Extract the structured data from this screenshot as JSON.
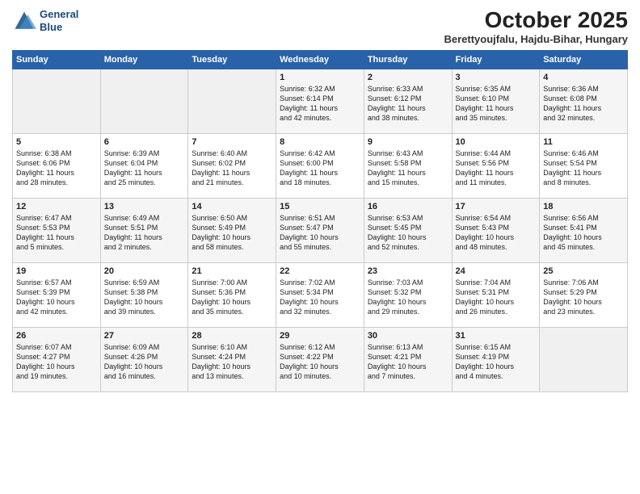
{
  "header": {
    "logo_line1": "General",
    "logo_line2": "Blue",
    "title": "October 2025",
    "subtitle": "Berettyoujfalu, Hajdu-Bihar, Hungary"
  },
  "days_of_week": [
    "Sunday",
    "Monday",
    "Tuesday",
    "Wednesday",
    "Thursday",
    "Friday",
    "Saturday"
  ],
  "weeks": [
    [
      {
        "day": null,
        "info": null
      },
      {
        "day": null,
        "info": null
      },
      {
        "day": null,
        "info": null
      },
      {
        "day": "1",
        "info": "Sunrise: 6:32 AM\nSunset: 6:14 PM\nDaylight: 11 hours\nand 42 minutes."
      },
      {
        "day": "2",
        "info": "Sunrise: 6:33 AM\nSunset: 6:12 PM\nDaylight: 11 hours\nand 38 minutes."
      },
      {
        "day": "3",
        "info": "Sunrise: 6:35 AM\nSunset: 6:10 PM\nDaylight: 11 hours\nand 35 minutes."
      },
      {
        "day": "4",
        "info": "Sunrise: 6:36 AM\nSunset: 6:08 PM\nDaylight: 11 hours\nand 32 minutes."
      }
    ],
    [
      {
        "day": "5",
        "info": "Sunrise: 6:38 AM\nSunset: 6:06 PM\nDaylight: 11 hours\nand 28 minutes."
      },
      {
        "day": "6",
        "info": "Sunrise: 6:39 AM\nSunset: 6:04 PM\nDaylight: 11 hours\nand 25 minutes."
      },
      {
        "day": "7",
        "info": "Sunrise: 6:40 AM\nSunset: 6:02 PM\nDaylight: 11 hours\nand 21 minutes."
      },
      {
        "day": "8",
        "info": "Sunrise: 6:42 AM\nSunset: 6:00 PM\nDaylight: 11 hours\nand 18 minutes."
      },
      {
        "day": "9",
        "info": "Sunrise: 6:43 AM\nSunset: 5:58 PM\nDaylight: 11 hours\nand 15 minutes."
      },
      {
        "day": "10",
        "info": "Sunrise: 6:44 AM\nSunset: 5:56 PM\nDaylight: 11 hours\nand 11 minutes."
      },
      {
        "day": "11",
        "info": "Sunrise: 6:46 AM\nSunset: 5:54 PM\nDaylight: 11 hours\nand 8 minutes."
      }
    ],
    [
      {
        "day": "12",
        "info": "Sunrise: 6:47 AM\nSunset: 5:53 PM\nDaylight: 11 hours\nand 5 minutes."
      },
      {
        "day": "13",
        "info": "Sunrise: 6:49 AM\nSunset: 5:51 PM\nDaylight: 11 hours\nand 2 minutes."
      },
      {
        "day": "14",
        "info": "Sunrise: 6:50 AM\nSunset: 5:49 PM\nDaylight: 10 hours\nand 58 minutes."
      },
      {
        "day": "15",
        "info": "Sunrise: 6:51 AM\nSunset: 5:47 PM\nDaylight: 10 hours\nand 55 minutes."
      },
      {
        "day": "16",
        "info": "Sunrise: 6:53 AM\nSunset: 5:45 PM\nDaylight: 10 hours\nand 52 minutes."
      },
      {
        "day": "17",
        "info": "Sunrise: 6:54 AM\nSunset: 5:43 PM\nDaylight: 10 hours\nand 48 minutes."
      },
      {
        "day": "18",
        "info": "Sunrise: 6:56 AM\nSunset: 5:41 PM\nDaylight: 10 hours\nand 45 minutes."
      }
    ],
    [
      {
        "day": "19",
        "info": "Sunrise: 6:57 AM\nSunset: 5:39 PM\nDaylight: 10 hours\nand 42 minutes."
      },
      {
        "day": "20",
        "info": "Sunrise: 6:59 AM\nSunset: 5:38 PM\nDaylight: 10 hours\nand 39 minutes."
      },
      {
        "day": "21",
        "info": "Sunrise: 7:00 AM\nSunset: 5:36 PM\nDaylight: 10 hours\nand 35 minutes."
      },
      {
        "day": "22",
        "info": "Sunrise: 7:02 AM\nSunset: 5:34 PM\nDaylight: 10 hours\nand 32 minutes."
      },
      {
        "day": "23",
        "info": "Sunrise: 7:03 AM\nSunset: 5:32 PM\nDaylight: 10 hours\nand 29 minutes."
      },
      {
        "day": "24",
        "info": "Sunrise: 7:04 AM\nSunset: 5:31 PM\nDaylight: 10 hours\nand 26 minutes."
      },
      {
        "day": "25",
        "info": "Sunrise: 7:06 AM\nSunset: 5:29 PM\nDaylight: 10 hours\nand 23 minutes."
      }
    ],
    [
      {
        "day": "26",
        "info": "Sunrise: 6:07 AM\nSunset: 4:27 PM\nDaylight: 10 hours\nand 19 minutes."
      },
      {
        "day": "27",
        "info": "Sunrise: 6:09 AM\nSunset: 4:26 PM\nDaylight: 10 hours\nand 16 minutes."
      },
      {
        "day": "28",
        "info": "Sunrise: 6:10 AM\nSunset: 4:24 PM\nDaylight: 10 hours\nand 13 minutes."
      },
      {
        "day": "29",
        "info": "Sunrise: 6:12 AM\nSunset: 4:22 PM\nDaylight: 10 hours\nand 10 minutes."
      },
      {
        "day": "30",
        "info": "Sunrise: 6:13 AM\nSunset: 4:21 PM\nDaylight: 10 hours\nand 7 minutes."
      },
      {
        "day": "31",
        "info": "Sunrise: 6:15 AM\nSunset: 4:19 PM\nDaylight: 10 hours\nand 4 minutes."
      },
      {
        "day": null,
        "info": null
      }
    ]
  ]
}
